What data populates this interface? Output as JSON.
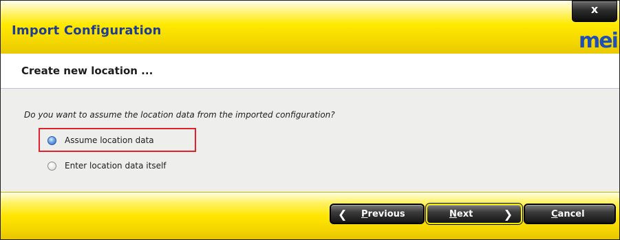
{
  "window": {
    "title": "Import Configuration",
    "close_label": "x",
    "logo": "mei"
  },
  "header": {
    "subtitle": "Create new location ..."
  },
  "main": {
    "question": "Do you want to assume the location data from the imported configuration?",
    "options": [
      {
        "label": "Assume location data",
        "checked": true
      },
      {
        "label": "Enter location data itself",
        "checked": false
      }
    ]
  },
  "footer": {
    "previous": {
      "hotkey": "P",
      "rest": "revious"
    },
    "next": {
      "hotkey": "N",
      "rest": "ext"
    },
    "cancel": {
      "hotkey": "C",
      "rest": "ancel"
    }
  },
  "colors": {
    "title_text": "#1f3d8f",
    "accent_yellow": "#ffe900",
    "highlight_red": "#e0202a",
    "radio_selected": "#2d64bd"
  }
}
